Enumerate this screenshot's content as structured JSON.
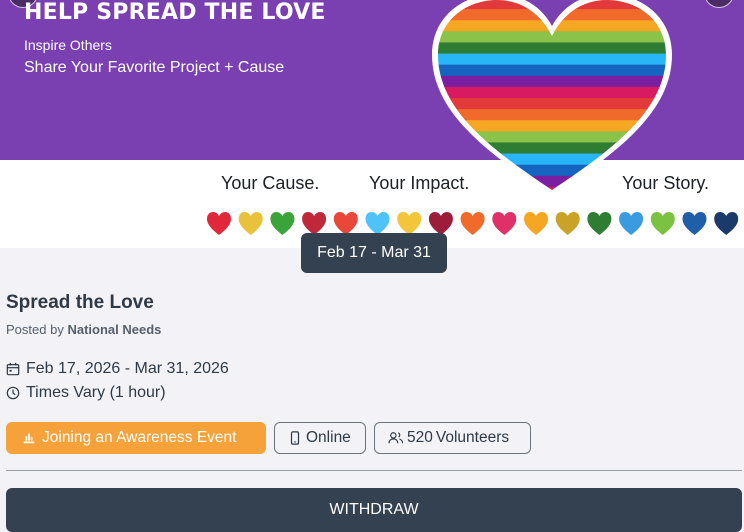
{
  "banner": {
    "title": "HELP SPREAD THE LOVE",
    "subtitle_1": "Inspire Others",
    "subtitle_2": "Share Your Favorite Project + Cause",
    "tagline_1": "Your Cause.",
    "tagline_2": "Your Impact.",
    "tagline_3": "Your Story.",
    "heart_stripe_colors": [
      "#e23a3a",
      "#ef6a2b",
      "#f5a623",
      "#8bc34a",
      "#2e7d32",
      "#29b6f6",
      "#1565c0",
      "#7b1fa2",
      "#d81b60"
    ],
    "small_heart_colors": [
      "#e0283a",
      "#e8c23a",
      "#3aa33a",
      "#c0283a",
      "#e8473a",
      "#4fc3f7",
      "#f2c53a",
      "#9b1d3a",
      "#ef6a2b",
      "#e0306a",
      "#f5a623",
      "#c9a227",
      "#2e7d32",
      "#3b9be0",
      "#7cc242",
      "#1f5fa8",
      "#1a3a6b"
    ]
  },
  "event": {
    "date_chip": "Feb 17 - Mar 31",
    "title": "Spread the Love",
    "posted_by_label": "Posted by",
    "organization": "National Needs",
    "date_range": "Feb 17, 2026 - Mar 31, 2026",
    "time": "Times Vary (1 hour)"
  },
  "tags": {
    "type": "Joining an Awareness Event",
    "location": "Online",
    "volunteers_count": "520",
    "volunteers_label": "Volunteers"
  },
  "actions": {
    "withdraw_label": "WITHDRAW"
  }
}
